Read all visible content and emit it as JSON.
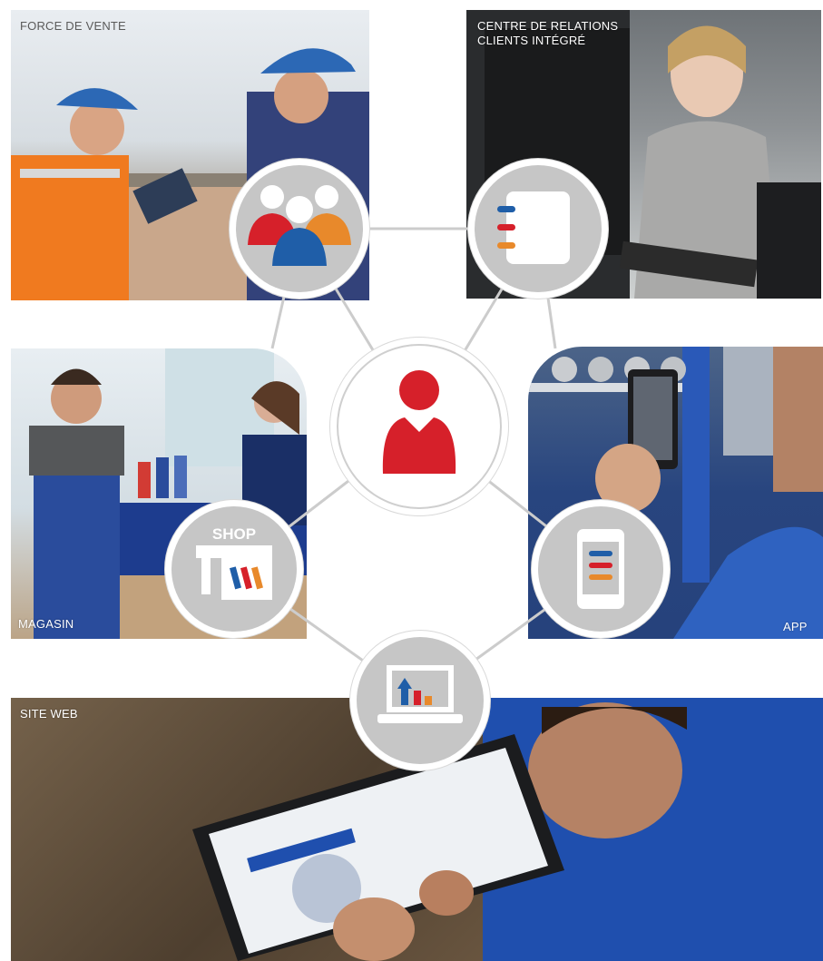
{
  "channels": {
    "sales_force": {
      "label": "FORCE DE VENTE"
    },
    "customer_center": {
      "label_line1": "CENTRE DE RELATIONS",
      "label_line2": "CLIENTS INTÉGRÉ"
    },
    "shop": {
      "label": "MAGASIN",
      "icon_text": "SHOP"
    },
    "app": {
      "label": "APP"
    },
    "website": {
      "label": "SITE WEB"
    }
  },
  "colors": {
    "red": "#d6202a",
    "blue": "#1f5ea8",
    "orange": "#e8892b",
    "node_gray": "#c6c6c6",
    "connector": "#cccccc"
  },
  "icons": [
    "team-icon",
    "contact-book-icon",
    "customer-icon",
    "shop-icon",
    "smartphone-icon",
    "laptop-chart-icon"
  ]
}
